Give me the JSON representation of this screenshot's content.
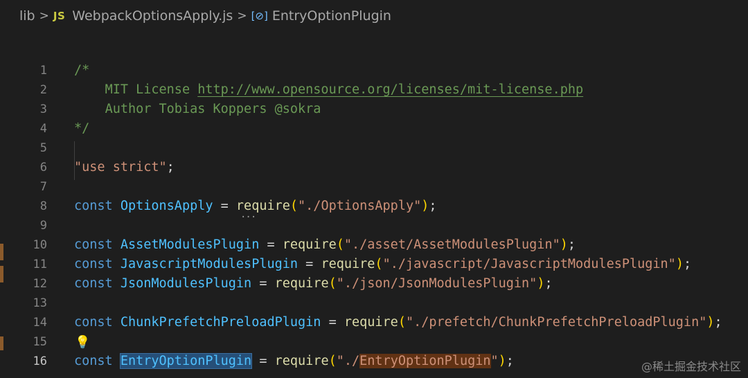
{
  "breadcrumbs": {
    "folder": "lib",
    "file_badge": "JS",
    "file": "WebpackOptionsApply.js",
    "symbol_icon": "symbol-variable-icon",
    "symbol": "EntryOptionPlugin",
    "separator": ">"
  },
  "editor": {
    "line_numbers": [
      "1",
      "2",
      "3",
      "4",
      "5",
      "6",
      "7",
      "8",
      "9",
      "10",
      "11",
      "12",
      "13",
      "14",
      "15",
      "16"
    ],
    "active_line": "16",
    "lines": {
      "l1": "/*",
      "l2_text": "MIT License ",
      "l2_link": "http://www.opensource.org/licenses/mit-license.php",
      "l3": "Author Tobias Koppers @sokra",
      "l4": "*/",
      "l6": "\"use strict\"",
      "semicolon": ";",
      "const": "const",
      "eq": " = ",
      "require": "require",
      "open_paren": "(",
      "close_paren": ")",
      "l8_name": "OptionsApply",
      "l8_str": "\"./OptionsApply\"",
      "l10_name": "AssetModulesPlugin",
      "l10_str": "\"./asset/AssetModulesPlugin\"",
      "l11_name": "JavascriptModulesPlugin",
      "l11_str": "\"./javascript/JavascriptModulesPlugin\"",
      "l12_name": "JsonModulesPlugin",
      "l12_str": "\"./json/JsonModulesPlugin\"",
      "l14_name": "ChunkPrefetchPreloadPlugin",
      "l14_str": "\"./prefetch/ChunkPrefetchPreloadPlugin\"",
      "l16_name": "EntryOptionPlugin",
      "l16_str_prefix": "\"./",
      "l16_str_match": "EntryOptionPlugin",
      "l16_str_suffix": "\""
    },
    "lightbulb_icon": "lightbulb-icon"
  },
  "watermark": "@稀土掘金技术社区",
  "colors": {
    "background": "#1e1e1e",
    "keyword": "#569cd6",
    "variable": "#4fc1ff",
    "function": "#dcdcaa",
    "string": "#ce9178",
    "comment": "#6a9955",
    "bracket": "#ffd700"
  }
}
